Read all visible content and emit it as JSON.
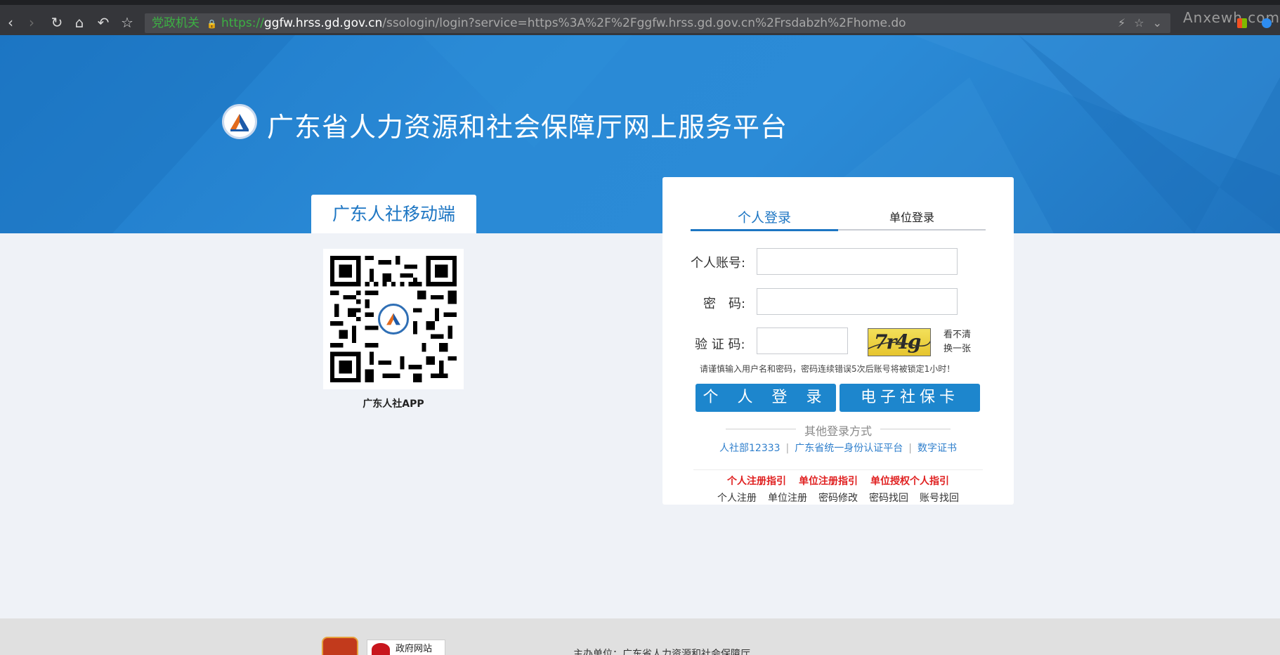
{
  "browser": {
    "url_badge": "党政机关",
    "url_scheme": "https://",
    "url_host": "ggfw.hrss.gd.gov.cn",
    "url_path": "/ssologin/login?service=https%3A%2F%2Fggfw.hrss.gd.gov.cn%2Frsdabzh%2Fhome.do",
    "watermark": "Anxewh.com",
    "icons": [
      "back-icon",
      "forward-icon",
      "reload-icon",
      "home-icon",
      "undo-icon",
      "star-icon",
      "lightning-icon",
      "favorite-icon",
      "chevron-down-icon"
    ]
  },
  "header": {
    "title": "广东省人力资源和社会保障厅网上服务平台"
  },
  "mobile": {
    "tab_label": "广东人社移动端",
    "app_caption": "广东人社APP"
  },
  "login": {
    "tabs": [
      "个人登录",
      "单位登录"
    ],
    "account_label": "个人账号:",
    "password_label": "密　码:",
    "captcha_label": "验 证 码:",
    "account_value": "",
    "password_value": "",
    "captcha_value": "",
    "captcha_image_text": "7r4g",
    "refresh_line1": "看不清",
    "refresh_line2": "换一张",
    "warning": "请谨慎输入用户名和密码，密码连续错误5次后账号将被锁定1小时！",
    "btn_personal": "个 人 登 录",
    "btn_card": "电子社保卡",
    "other_title": "其他登录方式",
    "other_links": [
      "人社部12333",
      "广东省统一身份认证平台",
      "数字证书"
    ],
    "guides": [
      "个人注册指引",
      "单位注册指引",
      "单位授权个人指引"
    ],
    "utilities": [
      "个人注册",
      "单位注册",
      "密码修改",
      "密码找回",
      "账号找回"
    ]
  },
  "footer": {
    "badge_text": "政府网站",
    "host_text": "主办单位：广东省人力资源和社会保障厅"
  },
  "colors": {
    "brand_blue": "#1d76c3",
    "button_blue": "#1d86cd",
    "guide_red": "#e02020"
  }
}
